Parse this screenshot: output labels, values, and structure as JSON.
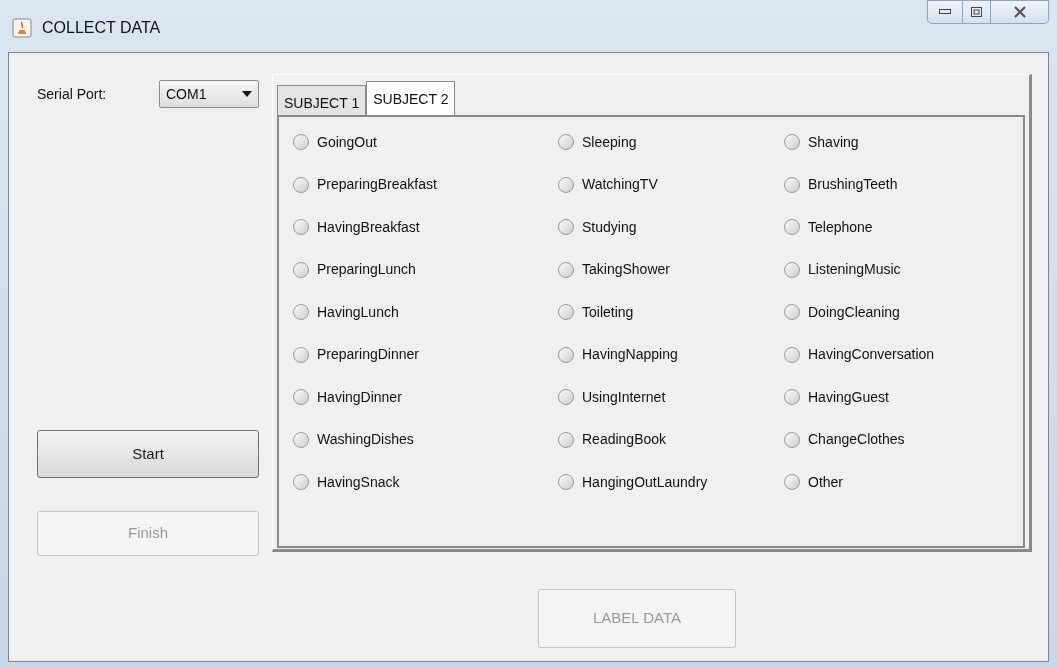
{
  "window": {
    "title": "COLLECT DATA"
  },
  "serial_port": {
    "label": "Serial Port:",
    "value": "COM1"
  },
  "buttons": [
    {
      "label": "Start",
      "disabled": false
    },
    {
      "label": "Finish",
      "disabled": true
    }
  ],
  "tabs": [
    {
      "label": "SUBJECT 1",
      "selected": false
    },
    {
      "label": "SUBJECT 2",
      "selected": true
    }
  ],
  "activities": [
    {
      "label": "GoingOut",
      "selected": false
    },
    {
      "label": "Sleeping",
      "selected": false
    },
    {
      "label": "Shaving",
      "selected": false
    },
    {
      "label": "PreparingBreakfast",
      "selected": false
    },
    {
      "label": "WatchingTV",
      "selected": false
    },
    {
      "label": "BrushingTeeth",
      "selected": false
    },
    {
      "label": "HavingBreakfast",
      "selected": false
    },
    {
      "label": "Studying",
      "selected": false
    },
    {
      "label": "Telephone",
      "selected": false
    },
    {
      "label": "PreparingLunch",
      "selected": false
    },
    {
      "label": "TakingShower",
      "selected": false
    },
    {
      "label": "ListeningMusic",
      "selected": false
    },
    {
      "label": "HavingLunch",
      "selected": false
    },
    {
      "label": "Toileting",
      "selected": false
    },
    {
      "label": "DoingCleaning",
      "selected": false
    },
    {
      "label": "PreparingDinner",
      "selected": false
    },
    {
      "label": "HavingNapping",
      "selected": false
    },
    {
      "label": "HavingConversation",
      "selected": false
    },
    {
      "label": "HavingDinner",
      "selected": false
    },
    {
      "label": "UsingInternet",
      "selected": false
    },
    {
      "label": "HavingGuest",
      "selected": false
    },
    {
      "label": "WashingDishes",
      "selected": false
    },
    {
      "label": "ReadingBook",
      "selected": false
    },
    {
      "label": "ChangeClothes",
      "selected": false
    },
    {
      "label": "HavingSnack",
      "selected": false
    },
    {
      "label": "HangingOutLaundry",
      "selected": false
    },
    {
      "label": "Other",
      "selected": false
    }
  ],
  "label_button": {
    "label": "LABEL DATA",
    "disabled": true
  }
}
